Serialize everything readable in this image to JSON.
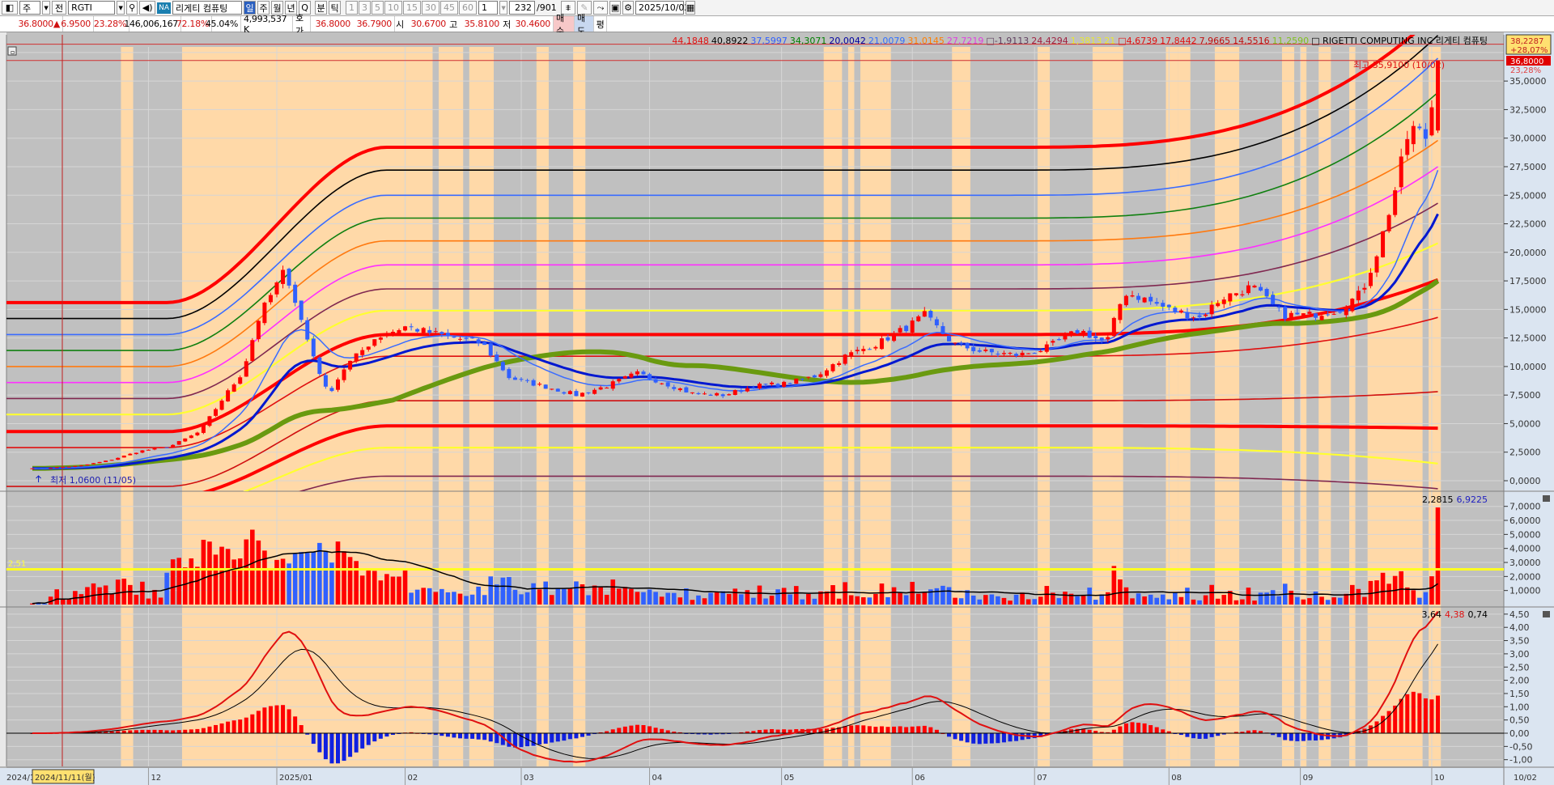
{
  "toolbar": {
    "period_select": "주",
    "all_label": "전",
    "symbol": "RGTI",
    "na_badge": "NA",
    "company_name": "리게티 컴퓨팅",
    "period_buttons": [
      "일",
      "주",
      "월",
      "년",
      "Q",
      "분",
      "틱"
    ],
    "selected_period": "일",
    "minute_buttons": [
      "1",
      "3",
      "5",
      "10",
      "15",
      "30",
      "45",
      "60"
    ],
    "interval_value": "1",
    "count_value": "232",
    "count_total": "/901",
    "date_value": "2025/10/02",
    "icons": [
      "layout-icon",
      "search-icon",
      "speaker-icon",
      "crosshair-icon",
      "tool-icon",
      "save-icon",
      "settings-icon",
      "calendar-icon"
    ]
  },
  "quote": {
    "price": "36.8000▲",
    "change": "6.9500",
    "change_pct": "23.28%",
    "volume": "146,006,167",
    "vol_ratio": "72.18%",
    "turnover": "45.04%",
    "amount": "4,993,537 K",
    "hoga_label": "호가",
    "ask": "36.8000",
    "bid": "36.7900",
    "open_label": "시",
    "open": "30.6700",
    "high_label": "고",
    "high": "35.8100",
    "low_label": "저",
    "low": "30.4600",
    "buy_label": "매수",
    "sell_label": "매도",
    "eval_label": "평"
  },
  "legend": [
    {
      "text": "44,1848",
      "color": "#e01010"
    },
    {
      "text": "40,8922",
      "color": "#000000"
    },
    {
      "text": "37,5997",
      "color": "#3060ff"
    },
    {
      "text": "34,3071",
      "color": "#008000"
    },
    {
      "text": "20,0042",
      "color": "#0000a0"
    },
    {
      "text": "21,0079",
      "color": "#3070ff"
    },
    {
      "text": "31,0145",
      "color": "#ff7f00"
    },
    {
      "text": "27,7219",
      "color": "#e040e0"
    },
    {
      "text": "□-1,9113",
      "color": "#604060"
    },
    {
      "text": "24,4294",
      "color": "#a02040"
    },
    {
      "text": "1,3813",
      "color": "#e8e830"
    },
    {
      "text": "21",
      "color": "#e8e830"
    },
    {
      "text": "□4,6739",
      "color": "#e01010"
    },
    {
      "text": "17,8442",
      "color": "#e01010"
    },
    {
      "text": "7,9665",
      "color": "#c01010"
    },
    {
      "text": "14,5516",
      "color": "#c01010"
    },
    {
      "text": "11,2590",
      "color": "#80c020"
    },
    {
      "text": "□ RIGETTI COMPUTING INC  리게티 컴퓨팅",
      "color": "#000000"
    }
  ],
  "price_panel": {
    "prev_high_box": {
      "value": "38,2287",
      "pct": "+28,07%"
    },
    "current_box": {
      "value": "36,8000",
      "pct": "23,28%"
    },
    "high_annotation": "최고 35,9100 (10/02)",
    "low_annotation": "최저 1,0600 (11/05)",
    "axis_labels": [
      "35,0000",
      "32,5000",
      "30,0000",
      "27,5000",
      "25,0000",
      "22,5000",
      "20,0000",
      "17,5000",
      "15,0000",
      "12,5000",
      "10,0000",
      "7,5000",
      "5,0000",
      "2,5000",
      "0,0000"
    ]
  },
  "volume_panel": {
    "ma_value": "2,2815",
    "last_value": "6,9225",
    "ref_label": "2,51",
    "axis_labels": [
      "7,0000",
      "6,0000",
      "5,0000",
      "4,0000",
      "3,0000",
      "2,0000",
      "1,0000"
    ]
  },
  "macd_panel": {
    "signal_value": "3,64",
    "macd_value": "4,38",
    "osc_value": "0,74",
    "axis_labels": [
      "4,50",
      "4,00",
      "3,50",
      "3,00",
      "2,50",
      "2,00",
      "1,50",
      "1,00",
      "0,50",
      "0,00",
      "-0,50",
      "-1,00"
    ]
  },
  "date_axis": {
    "start_label": "2024/1",
    "cursor_label": "2024/11/11(월)",
    "months": [
      "12",
      "2025/01",
      "02",
      "03",
      "04",
      "05",
      "06",
      "07",
      "08",
      "09",
      "10"
    ],
    "end_label": "10/02"
  },
  "colors": {
    "up": "#ff0000",
    "down": "#3060ff",
    "background": "#c0c0c0",
    "highlight": "#ffd9a8",
    "axis_bg": "#dbe5f1"
  },
  "chart_data": {
    "type": "candlestick",
    "symbol": "RGTI",
    "ylim": [
      0,
      39
    ],
    "close_keypoints": [
      [
        "2024-11-03",
        1.15
      ],
      [
        "2024-11-05",
        1.06
      ],
      [
        "2024-11-15",
        1.3
      ],
      [
        "2024-11-22",
        1.8
      ],
      [
        "2024-11-29",
        2.6
      ],
      [
        "2024-12-06",
        3.0
      ],
      [
        "2024-12-13",
        4.3
      ],
      [
        "2024-12-18",
        7.0
      ],
      [
        "2024-12-23",
        9.5
      ],
      [
        "2024-12-27",
        14.5
      ],
      [
        "2025-01-03",
        18.5
      ],
      [
        "2025-01-08",
        12.5
      ],
      [
        "2025-01-13",
        7.5
      ],
      [
        "2025-01-17",
        10.0
      ],
      [
        "2025-01-24",
        12.5
      ],
      [
        "2025-01-31",
        13.5
      ],
      [
        "2025-02-07",
        13.0
      ],
      [
        "2025-02-14",
        12.5
      ],
      [
        "2025-02-21",
        12.0
      ],
      [
        "2025-02-28",
        9.0
      ],
      [
        "2025-03-07",
        8.2
      ],
      [
        "2025-03-14",
        7.5
      ],
      [
        "2025-03-21",
        8.3
      ],
      [
        "2025-03-28",
        9.4
      ],
      [
        "2025-04-04",
        8.6
      ],
      [
        "2025-04-11",
        7.6
      ],
      [
        "2025-04-18",
        7.5
      ],
      [
        "2025-04-25",
        8.3
      ],
      [
        "2025-05-02",
        8.5
      ],
      [
        "2025-05-09",
        9.2
      ],
      [
        "2025-05-16",
        11.0
      ],
      [
        "2025-05-23",
        12.0
      ],
      [
        "2025-05-30",
        13.5
      ],
      [
        "2025-06-04",
        14.5
      ],
      [
        "2025-06-11",
        12.0
      ],
      [
        "2025-06-18",
        11.3
      ],
      [
        "2025-06-27",
        11.0
      ],
      [
        "2025-07-03",
        11.5
      ],
      [
        "2025-07-11",
        13.2
      ],
      [
        "2025-07-17",
        12.0
      ],
      [
        "2025-07-21",
        16.5
      ],
      [
        "2025-07-25",
        16.0
      ],
      [
        "2025-08-01",
        15.0
      ],
      [
        "2025-08-08",
        14.3
      ],
      [
        "2025-08-13",
        16.0
      ],
      [
        "2025-08-20",
        17.0
      ],
      [
        "2025-08-27",
        14.5
      ],
      [
        "2025-09-03",
        14.5
      ],
      [
        "2025-09-10",
        15.0
      ],
      [
        "2025-09-15",
        16.5
      ],
      [
        "2025-09-19",
        20.5
      ],
      [
        "2025-09-23",
        26.0
      ],
      [
        "2025-09-26",
        31.0
      ],
      [
        "2025-09-30",
        30.0
      ],
      [
        "2025-10-02",
        36.8
      ]
    ],
    "last_bar": {
      "open": 30.67,
      "high": 36.8,
      "low": 30.46,
      "close": 36.8
    },
    "envelope_lines": [
      {
        "color": "#ff0000",
        "start": 15.6,
        "mid": 29.2,
        "end": 41
      },
      {
        "color": "#000000",
        "start": 14.2,
        "mid": 27.2,
        "end": 39
      },
      {
        "color": "#3a6cff",
        "start": 12.8,
        "mid": 25.0,
        "end": 37
      },
      {
        "color": "#108010",
        "start": 11.4,
        "mid": 23.0,
        "end": 34
      },
      {
        "color": "#ff7a10",
        "start": 10.0,
        "mid": 21.0,
        "end": 29.8
      },
      {
        "color": "#ff30ff",
        "start": 8.6,
        "mid": 18.9,
        "end": 27.5
      },
      {
        "color": "#802850",
        "start": 7.2,
        "mid": 16.8,
        "end": 24.3
      },
      {
        "color": "#ffff30",
        "start": 5.8,
        "mid": 14.9,
        "end": 20.8
      },
      {
        "color": "#ff0000",
        "start": 4.3,
        "mid": 12.8,
        "end": 17.6
      },
      {
        "color": "#e01010",
        "start": 2.9,
        "mid": 10.9,
        "end": 14.3
      },
      {
        "color": "#d01010",
        "start": -0.5,
        "mid": 7.0,
        "end": 7.8
      },
      {
        "color": "#ff0000",
        "start": -1.5,
        "mid": 4.8,
        "end": 4.6
      },
      {
        "color": "#ffff30",
        "start": -2.5,
        "mid": 2.9,
        "end": 1.5
      },
      {
        "color": "#802850",
        "start": -3.5,
        "mid": 0.4,
        "end": -0.7
      }
    ],
    "highlight_ranges": [
      [
        15,
        16
      ],
      [
        25,
        65
      ],
      [
        67,
        70
      ],
      [
        72,
        75
      ],
      [
        83,
        84
      ],
      [
        89,
        90
      ],
      [
        130,
        132
      ],
      [
        134,
        134
      ],
      [
        136,
        140
      ],
      [
        151,
        153
      ],
      [
        165,
        166
      ],
      [
        174,
        178
      ],
      [
        186,
        187
      ],
      [
        188,
        189
      ],
      [
        194,
        197
      ],
      [
        205,
        206
      ],
      [
        208,
        208
      ],
      [
        211,
        212
      ],
      [
        216,
        216
      ],
      [
        219,
        227
      ],
      [
        229,
        230
      ]
    ],
    "volume_ref": 2.51,
    "volume_ylim": [
      0,
      7.7
    ],
    "macd_ylim": [
      -1.25,
      4.6
    ]
  }
}
